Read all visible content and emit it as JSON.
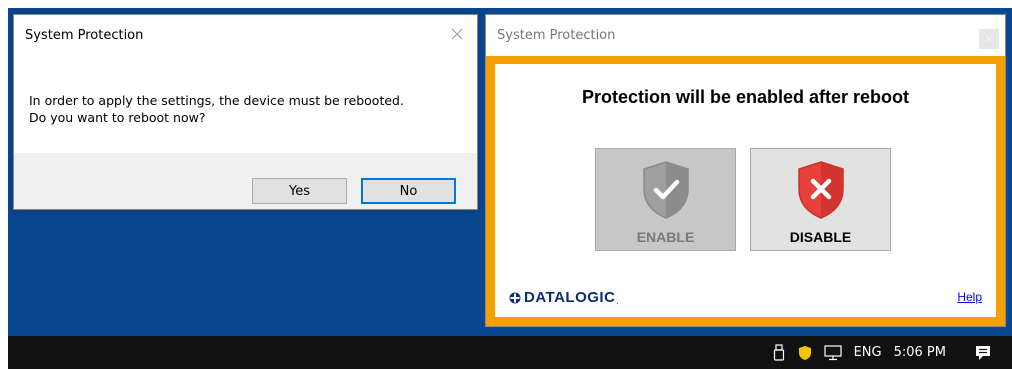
{
  "message_box": {
    "title": "System Protection",
    "message_line1": "In order to apply the settings, the device must be rebooted.",
    "message_line2": "Do you want to reboot now?",
    "yes_label": "Yes",
    "no_label": "No",
    "close_icon": "close-icon"
  },
  "protection_window": {
    "title": "System Protection",
    "heading": "Protection will be enabled after reboot",
    "enable_label": "ENABLE",
    "disable_label": "DISABLE",
    "enable_icon": "shield-check-icon",
    "disable_icon": "shield-x-icon",
    "logo_text": "DATALOGIC",
    "help_label": "Help",
    "frame_color": "#f5a000"
  },
  "taskbar": {
    "language": "ENG",
    "time": "5:06 PM",
    "icons": [
      "usb-icon",
      "shield-icon",
      "network-icon",
      "notification-icon"
    ]
  },
  "colors": {
    "desktop": "#0a4892",
    "taskbar": "#111111",
    "accent": "#0078d7",
    "disable_red": "#e8413c"
  }
}
